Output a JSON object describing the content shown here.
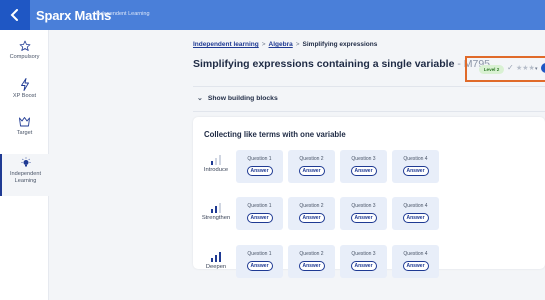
{
  "app": {
    "brand": "Sparx Maths",
    "subtitle": "Independent Learning"
  },
  "sidebar": {
    "items": [
      {
        "label": "Compulsory",
        "icon": "star-outline-icon"
      },
      {
        "label": "XP Boost",
        "icon": "lightning-icon"
      },
      {
        "label": "Target",
        "icon": "target-icon"
      },
      {
        "label": "Independent Learning",
        "icon": "lightbulb-icon",
        "active": true
      }
    ]
  },
  "breadcrumb": {
    "link1": "Independent learning",
    "link2": "Algebra",
    "current": "Simplifying expressions",
    "separator": ">"
  },
  "page": {
    "title": "Simplifying expressions containing a single variable",
    "code": "- M795"
  },
  "level": {
    "badge": "Level 2",
    "tick": "✓",
    "stars": "★★★",
    "dropdown": "▾"
  },
  "building_blocks": {
    "label": "Show building blocks",
    "chevron": "⌄"
  },
  "section": {
    "title": "Collecting like terms with one variable",
    "rows": [
      {
        "label": "Introduce",
        "level": 1,
        "questions": [
          {
            "label": "Question 1",
            "button": "Answer"
          },
          {
            "label": "Question 2",
            "button": "Answer"
          },
          {
            "label": "Question 3",
            "button": "Answer"
          },
          {
            "label": "Question 4",
            "button": "Answer"
          }
        ]
      },
      {
        "label": "Strengthen",
        "level": 2,
        "questions": [
          {
            "label": "Question 1",
            "button": "Answer"
          },
          {
            "label": "Question 2",
            "button": "Answer"
          },
          {
            "label": "Question 3",
            "button": "Answer"
          },
          {
            "label": "Question 4",
            "button": "Answer"
          }
        ]
      },
      {
        "label": "Deepen",
        "level": 3,
        "questions": [
          {
            "label": "Question 1",
            "button": "Answer"
          },
          {
            "label": "Question 2",
            "button": "Answer"
          },
          {
            "label": "Question 3",
            "button": "Answer"
          },
          {
            "label": "Question 4",
            "button": "Answer"
          }
        ]
      }
    ]
  },
  "colors": {
    "topbar": "#4a7fd9",
    "back": "#1f57c4",
    "navy": "#1f3a93",
    "highlight": "#e06a2a",
    "badge_bg": "#d9f1d3",
    "tile_bg": "#e8eef9"
  }
}
